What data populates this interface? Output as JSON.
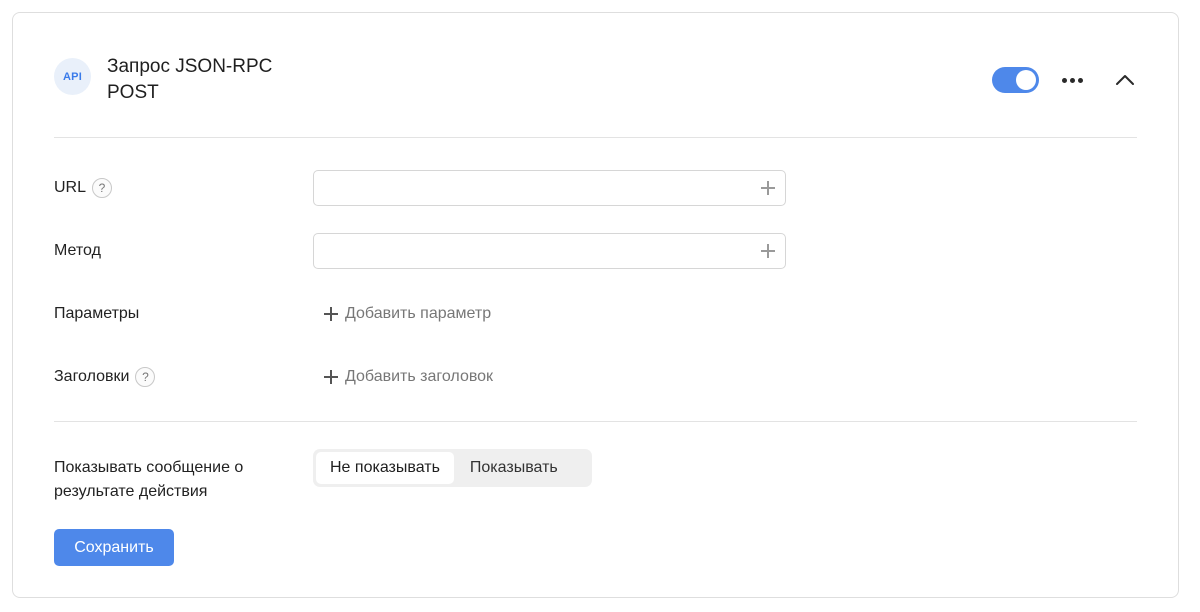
{
  "header": {
    "badge_text": "API",
    "title_line1": "Запрос JSON-RPC",
    "title_line2": "POST",
    "toggle_on": true,
    "accent_color": "#4e88ea"
  },
  "form": {
    "url": {
      "label": "URL",
      "help": "?",
      "value": ""
    },
    "method": {
      "label": "Метод",
      "value": ""
    },
    "params": {
      "label": "Параметры",
      "add_label": "Добавить параметр"
    },
    "headers": {
      "label": "Заголовки",
      "help": "?",
      "add_label": "Добавить заголовок"
    }
  },
  "message": {
    "label_line1": "Показывать сообщение о",
    "label_line2": "результате действия",
    "options": [
      "Не показывать",
      "Показывать"
    ],
    "selected": "Не показывать"
  },
  "actions": {
    "save_label": "Сохранить"
  },
  "icons": [
    "api-icon",
    "toggle-switch",
    "more-dots-icon",
    "chevron-up-icon",
    "plus-icon",
    "help-icon"
  ]
}
